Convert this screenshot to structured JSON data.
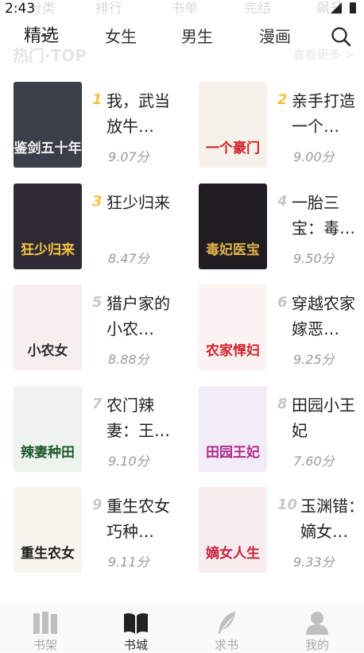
{
  "status_bar": {
    "time": "2:43"
  },
  "ghost_header": [
    "分类",
    "排行",
    "书单",
    "完结",
    "飙升"
  ],
  "tabs": [
    {
      "label": "精选",
      "active": true
    },
    {
      "label": "女生",
      "active": false
    },
    {
      "label": "男生",
      "active": false
    },
    {
      "label": "漫画",
      "active": false
    }
  ],
  "search_icon": "search-icon",
  "section": {
    "title": "热门·TOP",
    "more": "查看更多 >"
  },
  "books": [
    {
      "rank": "1",
      "title": "我，武当放牛…",
      "score": "9.07分",
      "cover_text": "鉴剑五十年",
      "cover_bg": "#3b3f4a",
      "cover_fg": "#f2f2f2",
      "highlight": true
    },
    {
      "rank": "2",
      "title": "亲手打造一个…",
      "score": "9.00分",
      "cover_text": "一个豪门",
      "cover_bg": "#f6f1ea",
      "cover_fg": "#d21f26",
      "highlight": true
    },
    {
      "rank": "3",
      "title": "狂少归来",
      "score": "8.47分",
      "cover_text": "狂少归来",
      "cover_bg": "#2e2b35",
      "cover_fg": "#f4c542",
      "highlight": true
    },
    {
      "rank": "4",
      "title": "一胎三宝：毒…",
      "score": "9.50分",
      "cover_text": "毒妃医宝",
      "cover_bg": "#1f1d22",
      "cover_fg": "#e2b24a",
      "highlight": false
    },
    {
      "rank": "5",
      "title": "猎户家的小农…",
      "score": "8.88分",
      "cover_text": "小农女",
      "cover_bg": "#f7eef0",
      "cover_fg": "#2b2b2b",
      "highlight": false
    },
    {
      "rank": "6",
      "title": "穿越农家嫁恶…",
      "score": "9.25分",
      "cover_text": "农家悍妇",
      "cover_bg": "#fbf3f1",
      "cover_fg": "#d4212d",
      "highlight": false
    },
    {
      "rank": "7",
      "title": "农门辣妻：王…",
      "score": "9.10分",
      "cover_text": "辣妻种田",
      "cover_bg": "#eef3ee",
      "cover_fg": "#1f5a2c",
      "highlight": false
    },
    {
      "rank": "8",
      "title": "田园小王妃",
      "score": "7.60分",
      "cover_text": "田园王妃",
      "cover_bg": "#f1ecf7",
      "cover_fg": "#b12a8a",
      "highlight": false
    },
    {
      "rank": "9",
      "title": "重生农女巧种…",
      "score": "9.11分",
      "cover_text": "重生农女",
      "cover_bg": "#f7f5ee",
      "cover_fg": "#1c1c1c",
      "highlight": false
    },
    {
      "rank": "10",
      "title": "玉渊错：嫡女…",
      "score": "9.33分",
      "cover_text": "嫡女人生",
      "cover_bg": "#f8ecef",
      "cover_fg": "#c9223a",
      "highlight": false
    }
  ],
  "bottom_nav": [
    {
      "label": "书架",
      "icon": "bookshelf-icon",
      "active": false
    },
    {
      "label": "书城",
      "icon": "book-open-icon",
      "active": true
    },
    {
      "label": "求书",
      "icon": "feather-icon",
      "active": false
    },
    {
      "label": "我的",
      "icon": "user-icon",
      "active": false
    }
  ],
  "colors": {
    "rank_highlight": "#f5c242",
    "rank_normal": "#c8c8c8",
    "score": "#9a9a9a"
  }
}
